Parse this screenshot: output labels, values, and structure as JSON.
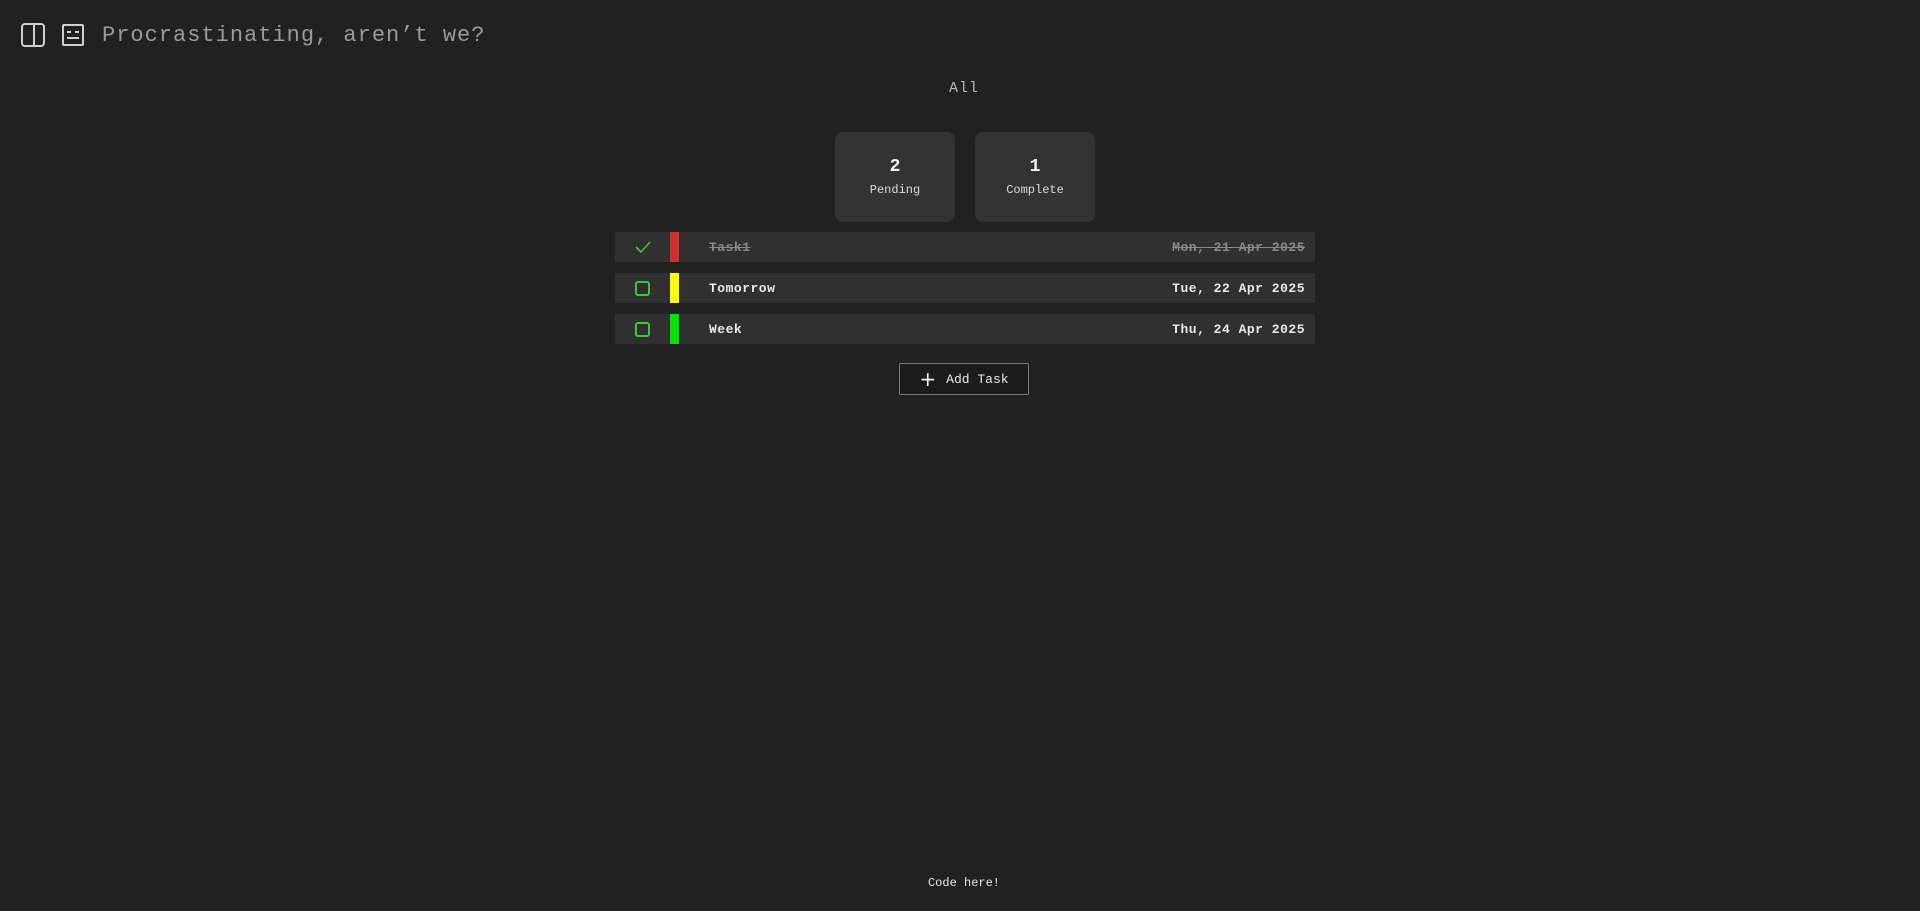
{
  "header": {
    "title": "Procrastinating, aren’t we?",
    "icons": [
      "sidebar-toggle-icon",
      "card-view-icon"
    ]
  },
  "filter": {
    "label": "All"
  },
  "stats": {
    "pending": {
      "count": "2",
      "label": "Pending"
    },
    "complete": {
      "count": "1",
      "label": "Complete"
    }
  },
  "tasks": [
    {
      "name": "Task1",
      "date": "Mon, 21 Apr 2025",
      "done": true,
      "priority_color": "#d32f2f"
    },
    {
      "name": "Tomorrow",
      "date": "Tue, 22 Apr 2025",
      "done": false,
      "priority_color": "#ffff00"
    },
    {
      "name": "Week",
      "date": "Thu, 24 Apr 2025",
      "done": false,
      "priority_color": "#00e600"
    }
  ],
  "actions": {
    "add_task_label": "Add Task"
  },
  "footer": {
    "link_label": "Code here!"
  },
  "colors": {
    "background": "#212121",
    "card": "#333333",
    "row": "#303030",
    "check_green": "#3cc63c"
  }
}
